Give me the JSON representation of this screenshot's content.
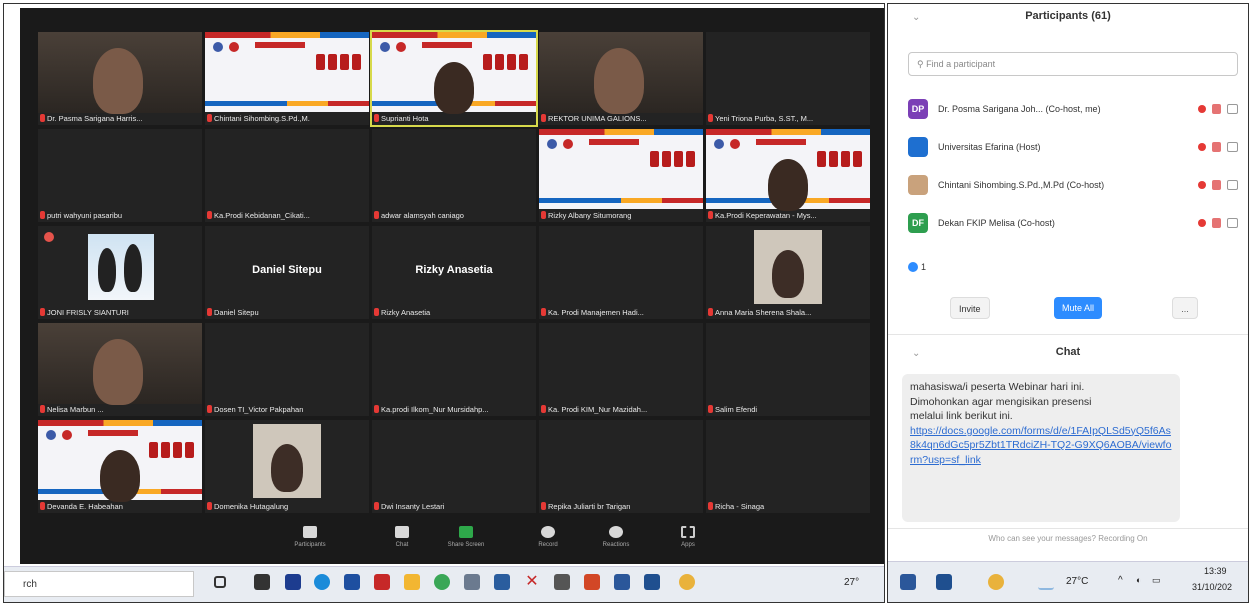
{
  "meeting": {
    "tiles": [
      {
        "name": "Dr. Pasma Sarigana Harris...",
        "kind": "photo"
      },
      {
        "name": "Chintani Sihombing.S.Pd.,M.",
        "kind": "banner"
      },
      {
        "name": "Suprianti Hota",
        "kind": "banner-active"
      },
      {
        "name": "REKTOR UNIMA GALIONS...",
        "kind": "photo"
      },
      {
        "name": "Yeni Triona Purba, S.ST., M...",
        "kind": "blank"
      },
      {
        "name": "putri wahyuni pasaribu",
        "kind": "blank"
      },
      {
        "name": "Ka.Prodi Kebidanan_Cikati...",
        "kind": "blank"
      },
      {
        "name": "adwar alamsyah caniago",
        "kind": "blank"
      },
      {
        "name": "Rizky Albany Situmorang",
        "kind": "banner"
      },
      {
        "name": "Ka.Prodi Keperawatan - Mys...",
        "kind": "banner-person"
      },
      {
        "name": "JONI FRISLY SIANTURI",
        "kind": "penguin"
      },
      {
        "name": "Daniel Sitepu",
        "kind": "center",
        "label": "Daniel Sitepu"
      },
      {
        "name": "Rizky Anasetia",
        "kind": "center",
        "label": "Rizky Anasetia"
      },
      {
        "name": "Ka. Prodi Manajemen Hadi...",
        "kind": "blank"
      },
      {
        "name": "Anna Maria Sherena Shala...",
        "kind": "photo-small"
      },
      {
        "name": "Nelisa Marbun ...",
        "kind": "photo"
      },
      {
        "name": "Dosen TI_Victor Pakpahan",
        "kind": "blank"
      },
      {
        "name": "Ka.prodi Ilkom_Nur Mursidahp...",
        "kind": "blank"
      },
      {
        "name": "Ka. Prodi KIM_Nur Mazidah...",
        "kind": "blank"
      },
      {
        "name": "Salim Efendi",
        "kind": "blank"
      },
      {
        "name": "Devanda E. Habeahan",
        "kind": "banner-person"
      },
      {
        "name": "Domenika Hutagalung",
        "kind": "photo-small"
      },
      {
        "name": "Dwi Insanty Lestari",
        "kind": "blank"
      },
      {
        "name": "Repika Juliarti br Tarigan",
        "kind": "blank"
      },
      {
        "name": "Richa - Sinaga",
        "kind": "blank"
      }
    ],
    "toolbar": [
      {
        "label": "Participants",
        "count": "61"
      },
      {
        "label": "Chat"
      },
      {
        "label": "Share Screen"
      },
      {
        "label": "Record"
      },
      {
        "label": "Reactions"
      },
      {
        "label": "Apps"
      }
    ]
  },
  "taskbar_left": {
    "search_text": "rch",
    "temp": "27°"
  },
  "participants": {
    "title": "Participants (61)",
    "search_placeholder": "Find a participant",
    "rows": [
      {
        "initials": "DP",
        "color": "#7b3fb6",
        "name": "Dr. Posma Sarigana Joh... (Co-host, me)"
      },
      {
        "initials": "",
        "color": "#1e6fd0",
        "name": "Universitas Efarina (Host)"
      },
      {
        "initials": "",
        "color": "#c9a27c",
        "name": "Chintani Sihombing.S.Pd.,M.Pd (Co-host)"
      },
      {
        "initials": "DF",
        "color": "#2e9e4f",
        "name": "Dekan FKIP Melisa (Co-host)"
      }
    ],
    "raised_hands": "1",
    "invite_label": "Invite",
    "mute_all_label": "Mute All",
    "more_label": "..."
  },
  "chat": {
    "title": "Chat",
    "message_lines": [
      "mahasiswa/i peserta Webinar hari ini.",
      "Dimohonkan agar mengisikan presensi",
      "melalui link berikut ini."
    ],
    "link": "https://docs.google.com/forms/d/e/1FAIpQLSd5yQ5f6As8k4qn6dGc5pr5Zbt1TRdciZH-TQ2-G9XQ6AOBA/viewform?usp=sf_link",
    "note": "Who can see your messages? Recording On"
  },
  "taskbar_right": {
    "temp": "27°C",
    "time": "13:39",
    "date": "31/10/202"
  },
  "colors": {
    "accent_blue": "#2d8cff",
    "meeting_bg": "#1a1a1a",
    "mic_red": "#e53935"
  }
}
